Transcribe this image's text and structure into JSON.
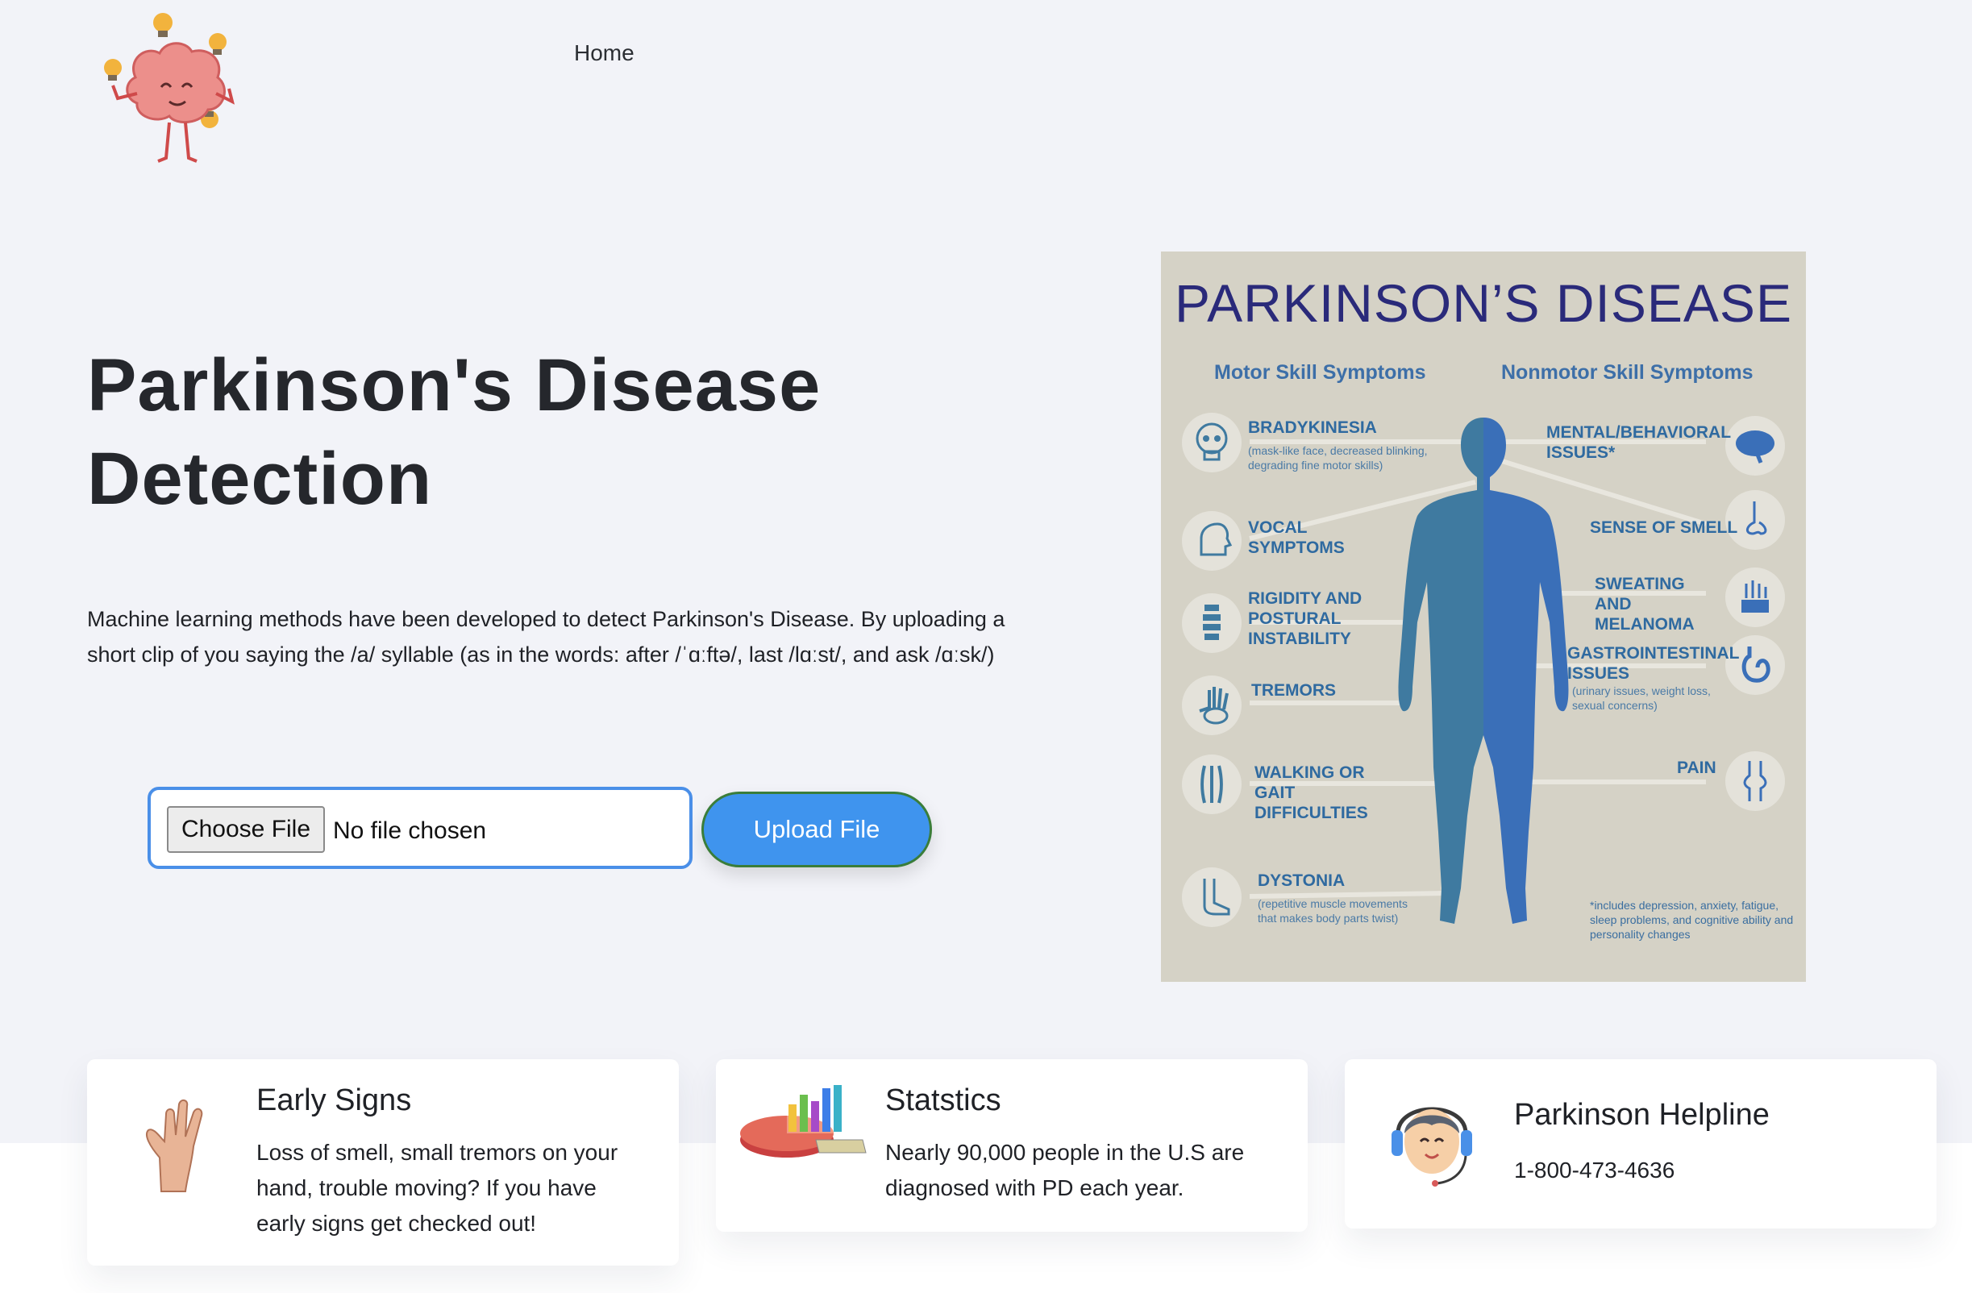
{
  "nav": {
    "home_label": "Home"
  },
  "hero": {
    "title": "Parkinson's Disease Detection",
    "description": "Machine learning methods have been developed to detect Parkinson's Disease. By uploading a short clip of you saying the /a/ syllable (as in the words: after /ˈɑːftə/, last /lɑːst/, and ask /ɑːsk/)"
  },
  "upload": {
    "choose_label": "Choose File",
    "no_file_text": "No file chosen",
    "submit_label": "Upload File"
  },
  "infographic": {
    "title": "PARKINSON’S DISEASE",
    "motor_heading": "Motor Skill Symptoms",
    "nonmotor_heading": "Nonmotor Skill Symptoms",
    "motor": [
      {
        "label": "BRADYKINESIA",
        "note": "(mask-like face, decreased blinking, degrading fine motor skills)",
        "icon": "skull-icon"
      },
      {
        "label": "VOCAL SYMPTOMS",
        "note": "",
        "icon": "head-profile-icon"
      },
      {
        "label": "RIGIDITY AND POSTURAL INSTABILITY",
        "note": "",
        "icon": "spine-icon"
      },
      {
        "label": "TREMORS",
        "note": "",
        "icon": "hand-bones-icon"
      },
      {
        "label": "WALKING OR GAIT DIFFICULTIES",
        "note": "",
        "icon": "muscle-icon"
      },
      {
        "label": "DYSTONIA",
        "note": "(repetitive muscle movements that makes body parts twist)",
        "icon": "foot-icon"
      }
    ],
    "nonmotor": [
      {
        "label": "MENTAL/BEHAVIORAL ISSUES*",
        "note": "",
        "icon": "brain-icon"
      },
      {
        "label": "SENSE OF SMELL",
        "note": "",
        "icon": "nose-icon"
      },
      {
        "label": "SWEATING AND MELANOMA",
        "note": "",
        "icon": "skin-icon"
      },
      {
        "label": "GASTROINTESTINAL ISSUES",
        "note": "(urinary issues, weight loss, sexual concerns)",
        "icon": "stomach-icon"
      },
      {
        "label": "PAIN",
        "note": "",
        "icon": "joint-icon"
      }
    ],
    "footnote": "*includes depression, anxiety, fatigue, sleep problems, and cognitive ability and personality changes",
    "colors": {
      "background": "#d5d2c6",
      "title": "#2a2a7a",
      "figure_left": "#3f7aa0",
      "figure_right": "#3a6fb8"
    }
  },
  "cards": [
    {
      "title": "Early Signs",
      "text": "Loss of smell, small tremors on your hand, trouble moving? If you have early signs get checked out!",
      "icon": "hand-icon"
    },
    {
      "title": "Statstics",
      "text": "Nearly 90,000 people in the U.S are diagnosed with PD each year.",
      "icon": "chart-icon"
    },
    {
      "title": "Parkinson Helpline",
      "text": "1-800-473-4636",
      "icon": "headset-agent-icon"
    }
  ]
}
